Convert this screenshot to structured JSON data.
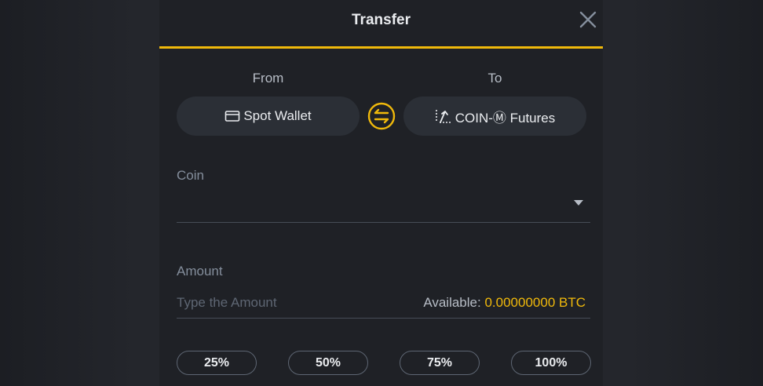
{
  "header": {
    "title": "Transfer",
    "close_icon": "close-icon"
  },
  "transfer": {
    "from_label": "From",
    "to_label": "To",
    "from_wallet": {
      "label": "Spot Wallet",
      "icon": "wallet-icon"
    },
    "to_wallet": {
      "label": "COIN-Ⓜ Futures",
      "icon": "futures-icon"
    },
    "swap_icon": "swap-arrows-icon"
  },
  "coin": {
    "label": "Coin",
    "value": ""
  },
  "amount": {
    "label": "Amount",
    "placeholder": "Type the Amount",
    "value": "",
    "available_label": "Available:",
    "available_value": "0.00000000 BTC"
  },
  "percent_buttons": [
    "25%",
    "50%",
    "75%",
    "100%"
  ],
  "colors": {
    "accent": "#f0b90b",
    "background": "#1f2126",
    "button": "#2b2f36",
    "text": "#eaecef",
    "muted": "#848e9c"
  }
}
